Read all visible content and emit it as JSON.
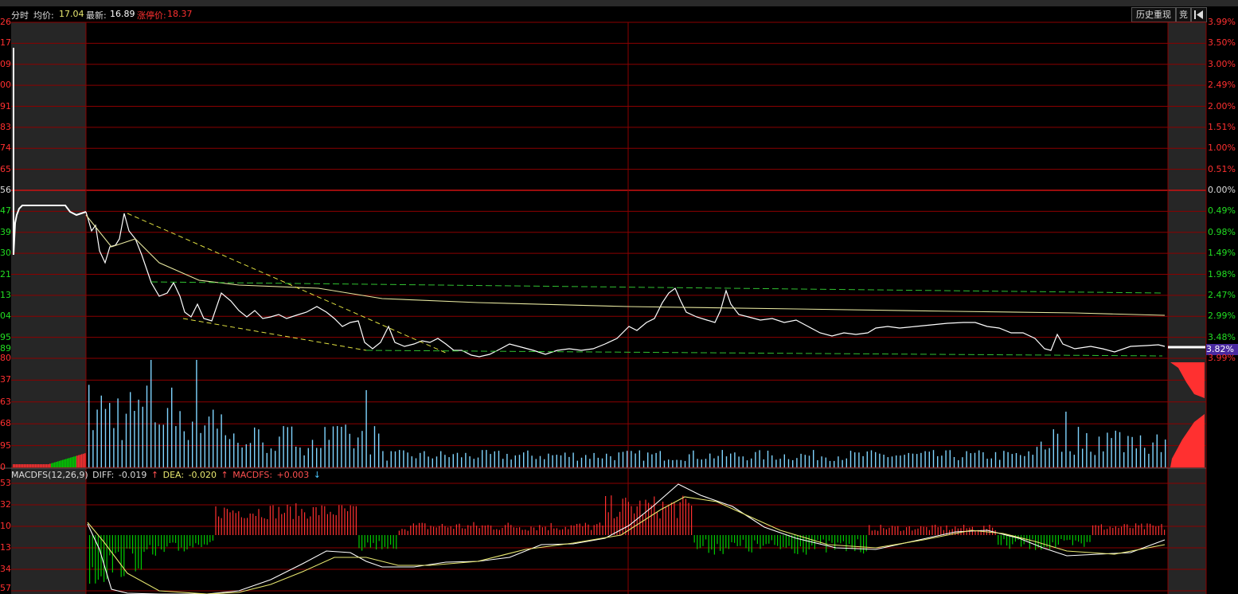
{
  "infobar": {
    "label_intraday": "分时",
    "label_avg": "均价:",
    "avg_value": "17.04",
    "label_latest": "最新:",
    "latest_value": "16.89",
    "label_limit_up": "涨停价:",
    "limit_up_value": "18.37"
  },
  "toolbar": {
    "history_replay": "历史重现",
    "auction": "竞"
  },
  "price_axis_left": [
    "26",
    "17",
    "09",
    "00",
    "91",
    "83",
    "74",
    "65",
    "56",
    "47",
    "39",
    "30",
    "21",
    "13",
    "04",
    "95",
    "89"
  ],
  "price_axis_right": [
    "3.99%",
    "3.50%",
    "3.00%",
    "2.49%",
    "2.00%",
    "1.51%",
    "1.00%",
    "0.51%",
    "0.00%",
    "0.49%",
    "0.98%",
    "1.49%",
    "1.98%",
    "2.47%",
    "2.99%",
    "3.48%"
  ],
  "current_pct": "3.82%",
  "volume_axis_left": [
    "80",
    "37",
    "63",
    "68",
    "95",
    "0"
  ],
  "volume_axis_right_top": "3.99%",
  "macd": {
    "title": "MACDFS(12,26,9)",
    "diff_label": "DIFF:",
    "diff_value": "-0.019",
    "dea_label": "DEA:",
    "dea_value": "-0.020",
    "macdfs_label": "MACDFS:",
    "macdfs_value": "+0.003",
    "axis_left": [
      "53",
      "32",
      "10",
      "13",
      "34",
      "57"
    ]
  },
  "colors": {
    "grid": "#8b0000",
    "price_line": "#ffffff",
    "avg_line": "#e8e8a0",
    "up": "#ff3030",
    "down": "#00cc00",
    "volume_bar": "#7fd4ff",
    "axis_red": "#ff3030",
    "axis_green": "#22dd22",
    "trend_yellow": "#e0e040",
    "trend_green": "#30c030"
  }
}
